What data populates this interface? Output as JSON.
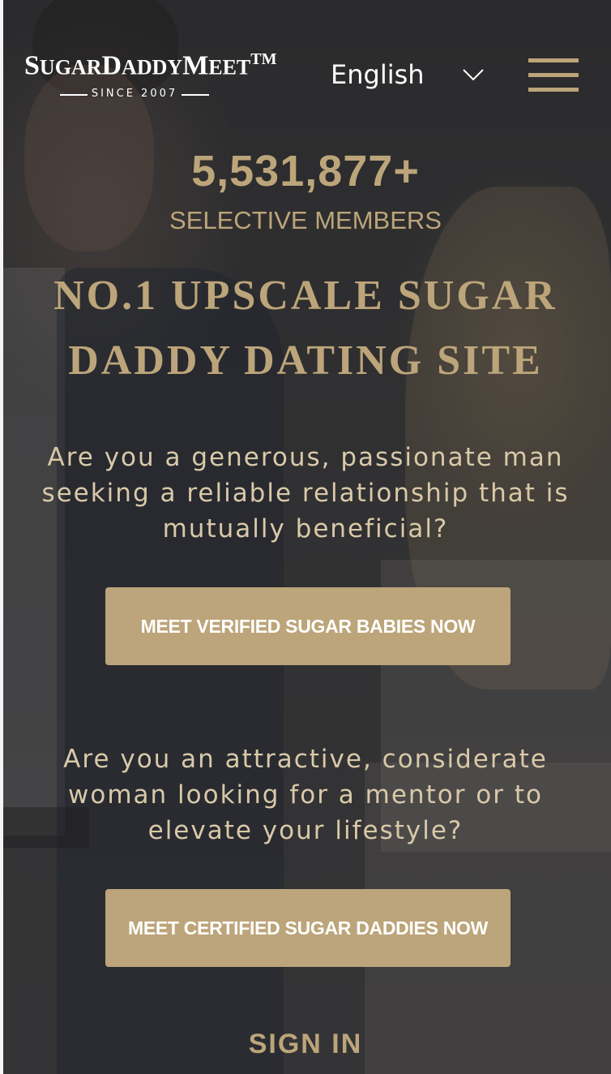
{
  "header": {
    "logo": {
      "brand_prefix": "S",
      "brand_part1": "UGAR",
      "brand_d": "D",
      "brand_part2": "ADDY",
      "brand_m": "M",
      "brand_part3": "EET",
      "trademark": "TM",
      "since": "SINCE 2007"
    },
    "language": {
      "selected": "English",
      "icon": "chevron-down-icon"
    },
    "menu_icon": "hamburger-menu-icon"
  },
  "stats": {
    "member_count": "5,531,877+",
    "member_label": "SELECTIVE MEMBERS"
  },
  "hero": {
    "headline_line1": "NO.1 UPSCALE SUGAR",
    "headline_line2": "DADDY DATING SITE"
  },
  "men": {
    "question": "Are you a generous, passionate man seeking a reliable relationship that is mutually beneficial?",
    "cta_label": "MEET VERIFIED SUGAR BABIES NOW"
  },
  "women": {
    "question": "Are you an attractive, considerate woman looking for a mentor or to elevate your lifestyle?",
    "cta_label": "MEET CERTIFIED SUGAR DADDIES NOW"
  },
  "footer": {
    "signin_label": "SIGN IN"
  },
  "colors": {
    "gold": "#bca57a",
    "text_light": "#d9c9a8",
    "white": "#ffffff",
    "overlay": "#3a3a3c"
  }
}
